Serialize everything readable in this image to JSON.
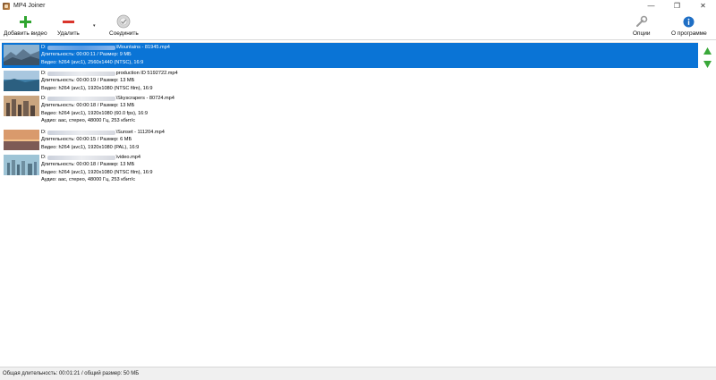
{
  "window": {
    "title": "MP4 Joiner",
    "controls": [
      "—",
      "❐",
      "✕"
    ]
  },
  "toolbar": {
    "add_label": "Добавить видео",
    "remove_label": "Удалить",
    "join_label": "Соединить",
    "options_label": "Опции",
    "about_label": "О программе",
    "dropdown_glyph": "▾"
  },
  "files": [
    {
      "path_start": "D:",
      "path_end": "\\Mountains - 81945.mp4",
      "line2": "Длительность: 00:00:11 / Размер: 9 МБ",
      "line3": "Видео: h264 (avc1), 2560x1440 (NTSC), 16:9",
      "line4": "",
      "selected": true,
      "thumbnail": "mountains"
    },
    {
      "path_start": "D:",
      "path_end": "production ID 5192722.mp4",
      "line2": "Длительность: 00:00:19 / Размер: 13 МБ",
      "line3": "Видео: h264 (avc1), 1920x1080 (NTSC film), 16:9",
      "line4": "",
      "selected": false,
      "thumbnail": "coast"
    },
    {
      "path_start": "D:",
      "path_end": "\\Skyscrapers - 80724.mp4",
      "line2": "Длительность: 00:00:18 / Размер: 13 МБ",
      "line3": "Видео: h264 (avc1), 1920x1080 (60.0 fps), 16:9",
      "line4": "Аудио: aac, стерео, 48000 Гц, 253 кбит/с",
      "selected": false,
      "thumbnail": "skyscrapers"
    },
    {
      "path_start": "D:",
      "path_end": "\\Sunset - 111204.mp4",
      "line2": "Длительность: 00:00:15 / Размер: 6 МБ",
      "line3": "Видео: h264 (avc1), 1920x1080 (PAL), 16:9",
      "line4": "",
      "selected": false,
      "thumbnail": "sunset"
    },
    {
      "path_start": "D:",
      "path_end": "\\video.mp4",
      "line2": "Длительность: 00:00:18 / Размер: 13 МБ",
      "line3": "Видео: h264 (avc1), 1920x1080 (NTSC film), 16:9",
      "line4": "Аудио: aac, стерео, 48000 Гц, 253 кбит/с",
      "selected": false,
      "thumbnail": "city"
    }
  ],
  "side_arrows": {
    "up": "arrow-up-icon",
    "down": "arrow-down-icon",
    "color": "#3aa83a"
  },
  "status": {
    "text": "Общая длительность: 00:01:21 / общий размер: 50 МБ"
  },
  "colors": {
    "selection": "#0a74d6",
    "add_icon": "#2fa52f",
    "remove_icon": "#d9342b",
    "about_icon": "#1f6fc5"
  }
}
